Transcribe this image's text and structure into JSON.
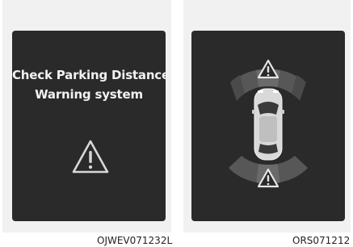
{
  "left_panel": {
    "message_line1": "Check Parking Distance",
    "message_line2": "Warning system",
    "icon": "warning-triangle-icon",
    "caption": "OJWEV071232L"
  },
  "right_panel": {
    "front_icon": "warning-triangle-icon",
    "rear_icon": "warning-triangle-icon",
    "car_icon": "car-top-view-icon",
    "caption": "ORS071212"
  },
  "colors": {
    "screen_bg": "#2a2a2a",
    "panel_bg": "#f1f1f1",
    "sensor_zone": "#5a5a5a",
    "text": "#f2f2f2"
  }
}
